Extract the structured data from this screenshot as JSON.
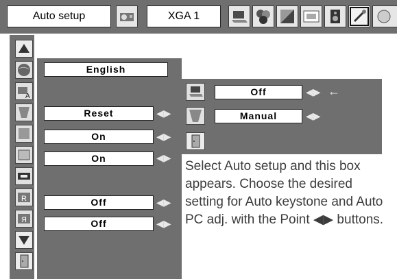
{
  "header": {
    "title": "Auto setup",
    "source": "XGA 1"
  },
  "menu": {
    "language": "English",
    "reset": "Reset",
    "row1": "On",
    "row2": "On",
    "row3": "Off",
    "row4": "Off"
  },
  "submenu": {
    "auto_keystone": "Off",
    "keystone_mode": "Manual"
  },
  "description": "Select Auto setup and this box appears. Choose the desired setting for Auto keystone and Auto PC adj. with the Point ◀▶ buttons.",
  "glyphs": {
    "lr": "◀▶",
    "pointer": "←",
    "up": "▲",
    "down": "▼"
  }
}
